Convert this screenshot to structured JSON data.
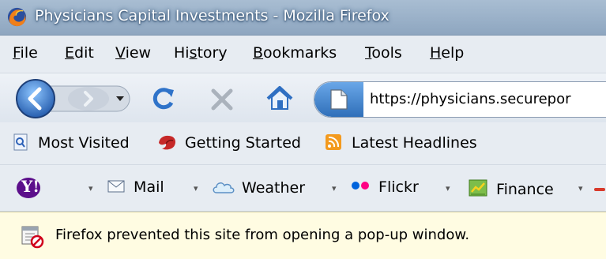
{
  "window": {
    "title": "Physicians Capital Investments - Mozilla Firefox",
    "app_icon": "firefox-icon"
  },
  "menu": [
    {
      "label": "File",
      "accel": "F",
      "rest": "ile"
    },
    {
      "label": "Edit",
      "accel": "E",
      "rest": "dit"
    },
    {
      "label": "View",
      "accel": "V",
      "rest": "iew"
    },
    {
      "label": "History",
      "prefix": "Hi",
      "accel": "s",
      "rest": "tory"
    },
    {
      "label": "Bookmarks",
      "accel": "B",
      "rest": "ookmarks"
    },
    {
      "label": "Tools",
      "accel": "T",
      "rest": "ools"
    },
    {
      "label": "Help",
      "accel": "H",
      "rest": "elp"
    }
  ],
  "navigation": {
    "back_icon": "back-arrow-icon",
    "forward_icon": "forward-arrow-icon",
    "history_dropdown_icon": "chevron-down-icon",
    "reload_icon": "reload-icon",
    "stop_icon": "stop-icon",
    "home_icon": "home-icon",
    "url": "https://physicians.securepor"
  },
  "bookmarks_toolbar": [
    {
      "label": "Most Visited",
      "icon": "magnifier-page-icon"
    },
    {
      "label": "Getting Started",
      "icon": "firefox-logo-icon"
    },
    {
      "label": "Latest Headlines",
      "icon": "rss-feed-icon"
    }
  ],
  "yahoo_toolbar": {
    "logo": "Y!",
    "items": [
      {
        "label": "Mail",
        "icon": "envelope-icon"
      },
      {
        "label": "Weather",
        "icon": "cloud-icon"
      },
      {
        "label": "Flickr",
        "icon": "flickr-dots-icon"
      },
      {
        "label": "Finance",
        "icon": "finance-chart-icon"
      }
    ]
  },
  "notification": {
    "message": "Firefox prevented this site from opening a pop-up window.",
    "icon": "popup-blocked-icon"
  },
  "colors": {
    "titlebar": "#98afc8",
    "notification_bg": "#fffce2",
    "yahoo_purple": "#5c0f8b",
    "flickr_blue": "#0063dc",
    "flickr_pink": "#ff0084"
  }
}
